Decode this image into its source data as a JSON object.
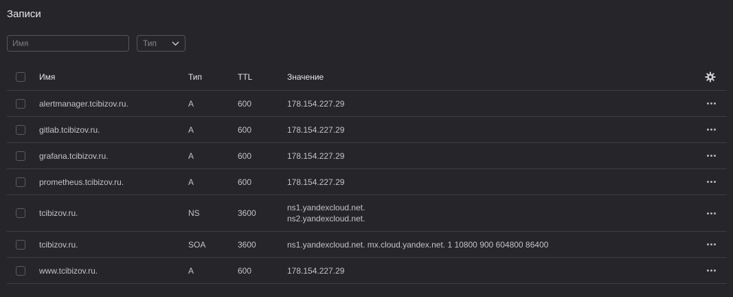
{
  "header": {
    "title": "Записи"
  },
  "filters": {
    "name_placeholder": "Имя",
    "name_value": "",
    "type_label": "Тип"
  },
  "table": {
    "columns": {
      "name": "Имя",
      "type": "Тип",
      "ttl": "TTL",
      "value": "Значение"
    },
    "rows": [
      {
        "name": "alertmanager.tcibizov.ru.",
        "type": "A",
        "ttl": "600",
        "values": [
          "178.154.227.29"
        ]
      },
      {
        "name": "gitlab.tcibizov.ru.",
        "type": "A",
        "ttl": "600",
        "values": [
          "178.154.227.29"
        ]
      },
      {
        "name": "grafana.tcibizov.ru.",
        "type": "A",
        "ttl": "600",
        "values": [
          "178.154.227.29"
        ]
      },
      {
        "name": "prometheus.tcibizov.ru.",
        "type": "A",
        "ttl": "600",
        "values": [
          "178.154.227.29"
        ]
      },
      {
        "name": "tcibizov.ru.",
        "type": "NS",
        "ttl": "3600",
        "values": [
          "ns1.yandexcloud.net.",
          "ns2.yandexcloud.net."
        ]
      },
      {
        "name": "tcibizov.ru.",
        "type": "SOA",
        "ttl": "3600",
        "values": [
          "ns1.yandexcloud.net. mx.cloud.yandex.net. 1 10800 900 604800 86400"
        ]
      },
      {
        "name": "www.tcibizov.ru.",
        "type": "A",
        "ttl": "600",
        "values": [
          "178.154.227.29"
        ]
      }
    ]
  },
  "icons": {
    "settings": "gear-icon",
    "row_actions": "more-horizontal-icon",
    "dropdown": "chevron-down-icon"
  }
}
